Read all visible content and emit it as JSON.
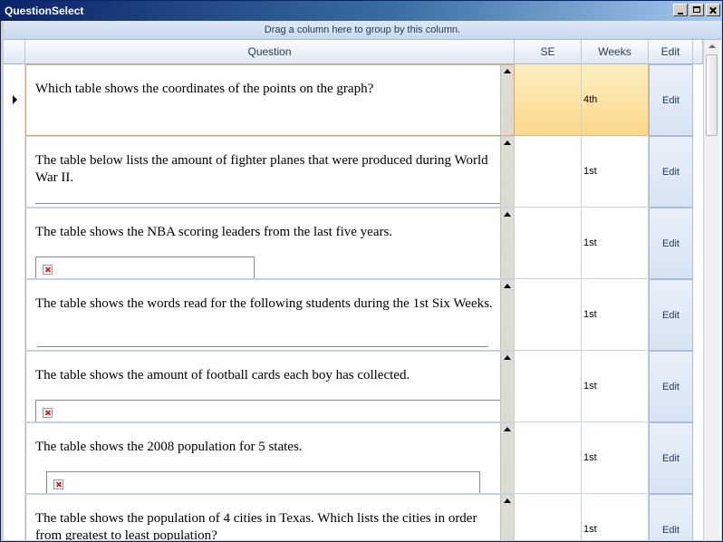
{
  "window": {
    "title": "QuestionSelect"
  },
  "group_panel": {
    "text": "Drag a column here to group by this column."
  },
  "columns": {
    "question": "Question",
    "se": "SE",
    "weeks": "Weeks",
    "edit": "Edit"
  },
  "rows": [
    {
      "question": "Which table shows the coordinates of the points on the graph?",
      "se": "",
      "weeks": "4th",
      "edit": "Edit"
    },
    {
      "question": "The table below lists the amount of fighter planes that were produced during World War II.",
      "se": "",
      "weeks": "1st",
      "edit": "Edit"
    },
    {
      "question": "The table shows the NBA scoring leaders from the last five years.",
      "se": "",
      "weeks": "1st",
      "edit": "Edit"
    },
    {
      "question": "The table shows the words read for the following students during the 1st Six Weeks.",
      "se": "",
      "weeks": "1st",
      "edit": "Edit"
    },
    {
      "question": "The table shows the amount of football cards each boy has collected.",
      "se": "",
      "weeks": "1st",
      "edit": "Edit"
    },
    {
      "question": "The table shows the 2008 population for 5 states.",
      "se": "",
      "weeks": "1st",
      "edit": "Edit"
    },
    {
      "question": "The table shows the population of 4 cities in Texas.  Which lists the cities in order from greatest to least population?",
      "se": "",
      "weeks": "1st",
      "edit": "Edit"
    }
  ],
  "colors": {
    "title_bar": "#0a246a",
    "current_row": "#fbd98a",
    "header": "#dfe8f4"
  },
  "icons": {
    "current_row": "row-pointer-icon",
    "broken_image": "broken-image-icon"
  }
}
